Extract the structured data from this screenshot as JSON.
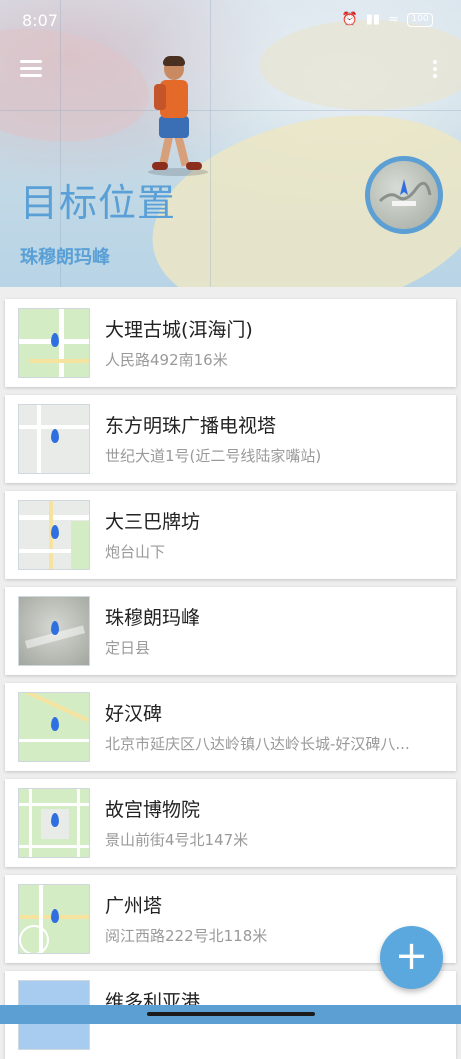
{
  "status_bar": {
    "time": "8:07",
    "battery": "100"
  },
  "header": {
    "title": "目标位置",
    "subtitle": "珠穆朗玛峰",
    "accent_color": "#5aa0d6",
    "menu_icon": "menu-icon",
    "more_icon": "more-vertical-icon"
  },
  "locations": [
    {
      "name": "大理古城(洱海门)",
      "address": "人民路492南16米",
      "thumb": "street-map"
    },
    {
      "name": "东方明珠广播电视塔",
      "address": "世纪大道1号(近二号线陆家嘴站)",
      "thumb": "street-map"
    },
    {
      "name": "大三巴牌坊",
      "address": "炮台山下",
      "thumb": "street-map"
    },
    {
      "name": "珠穆朗玛峰",
      "address": "定日县",
      "thumb": "satellite-map"
    },
    {
      "name": "好汉碑",
      "address": "北京市延庆区八达岭镇八达岭长城-好汉碑八...",
      "thumb": "street-map"
    },
    {
      "name": "故宫博物院",
      "address": "景山前街4号北147米",
      "thumb": "street-map"
    },
    {
      "name": "广州塔",
      "address": "阅江西路222号北118米",
      "thumb": "street-map"
    },
    {
      "name": "维多利亚港",
      "address": "",
      "thumb": "street-map"
    }
  ],
  "fab": {
    "label": "+",
    "icon": "plus-icon"
  }
}
